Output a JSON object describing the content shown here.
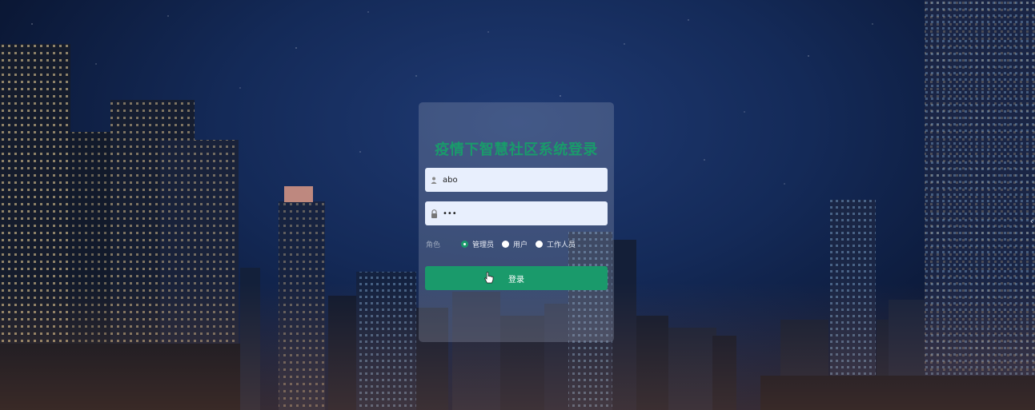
{
  "login": {
    "title": "疫情下智慧社区系统登录",
    "username_value": "abo",
    "password_mask": "•••",
    "role_label": "角色",
    "roles": [
      {
        "label": "管理员",
        "checked": true
      },
      {
        "label": "用户",
        "checked": false
      },
      {
        "label": "工作人员",
        "checked": false
      }
    ],
    "submit_label": "登录"
  },
  "colors": {
    "accent": "#1a9a6b",
    "field_bg": "#e8effd"
  },
  "icons": {
    "user_field": "user-icon",
    "password_field": "lock-icon",
    "cursor": "pointer-hand-icon",
    "edge": "chevron-left-icon"
  }
}
